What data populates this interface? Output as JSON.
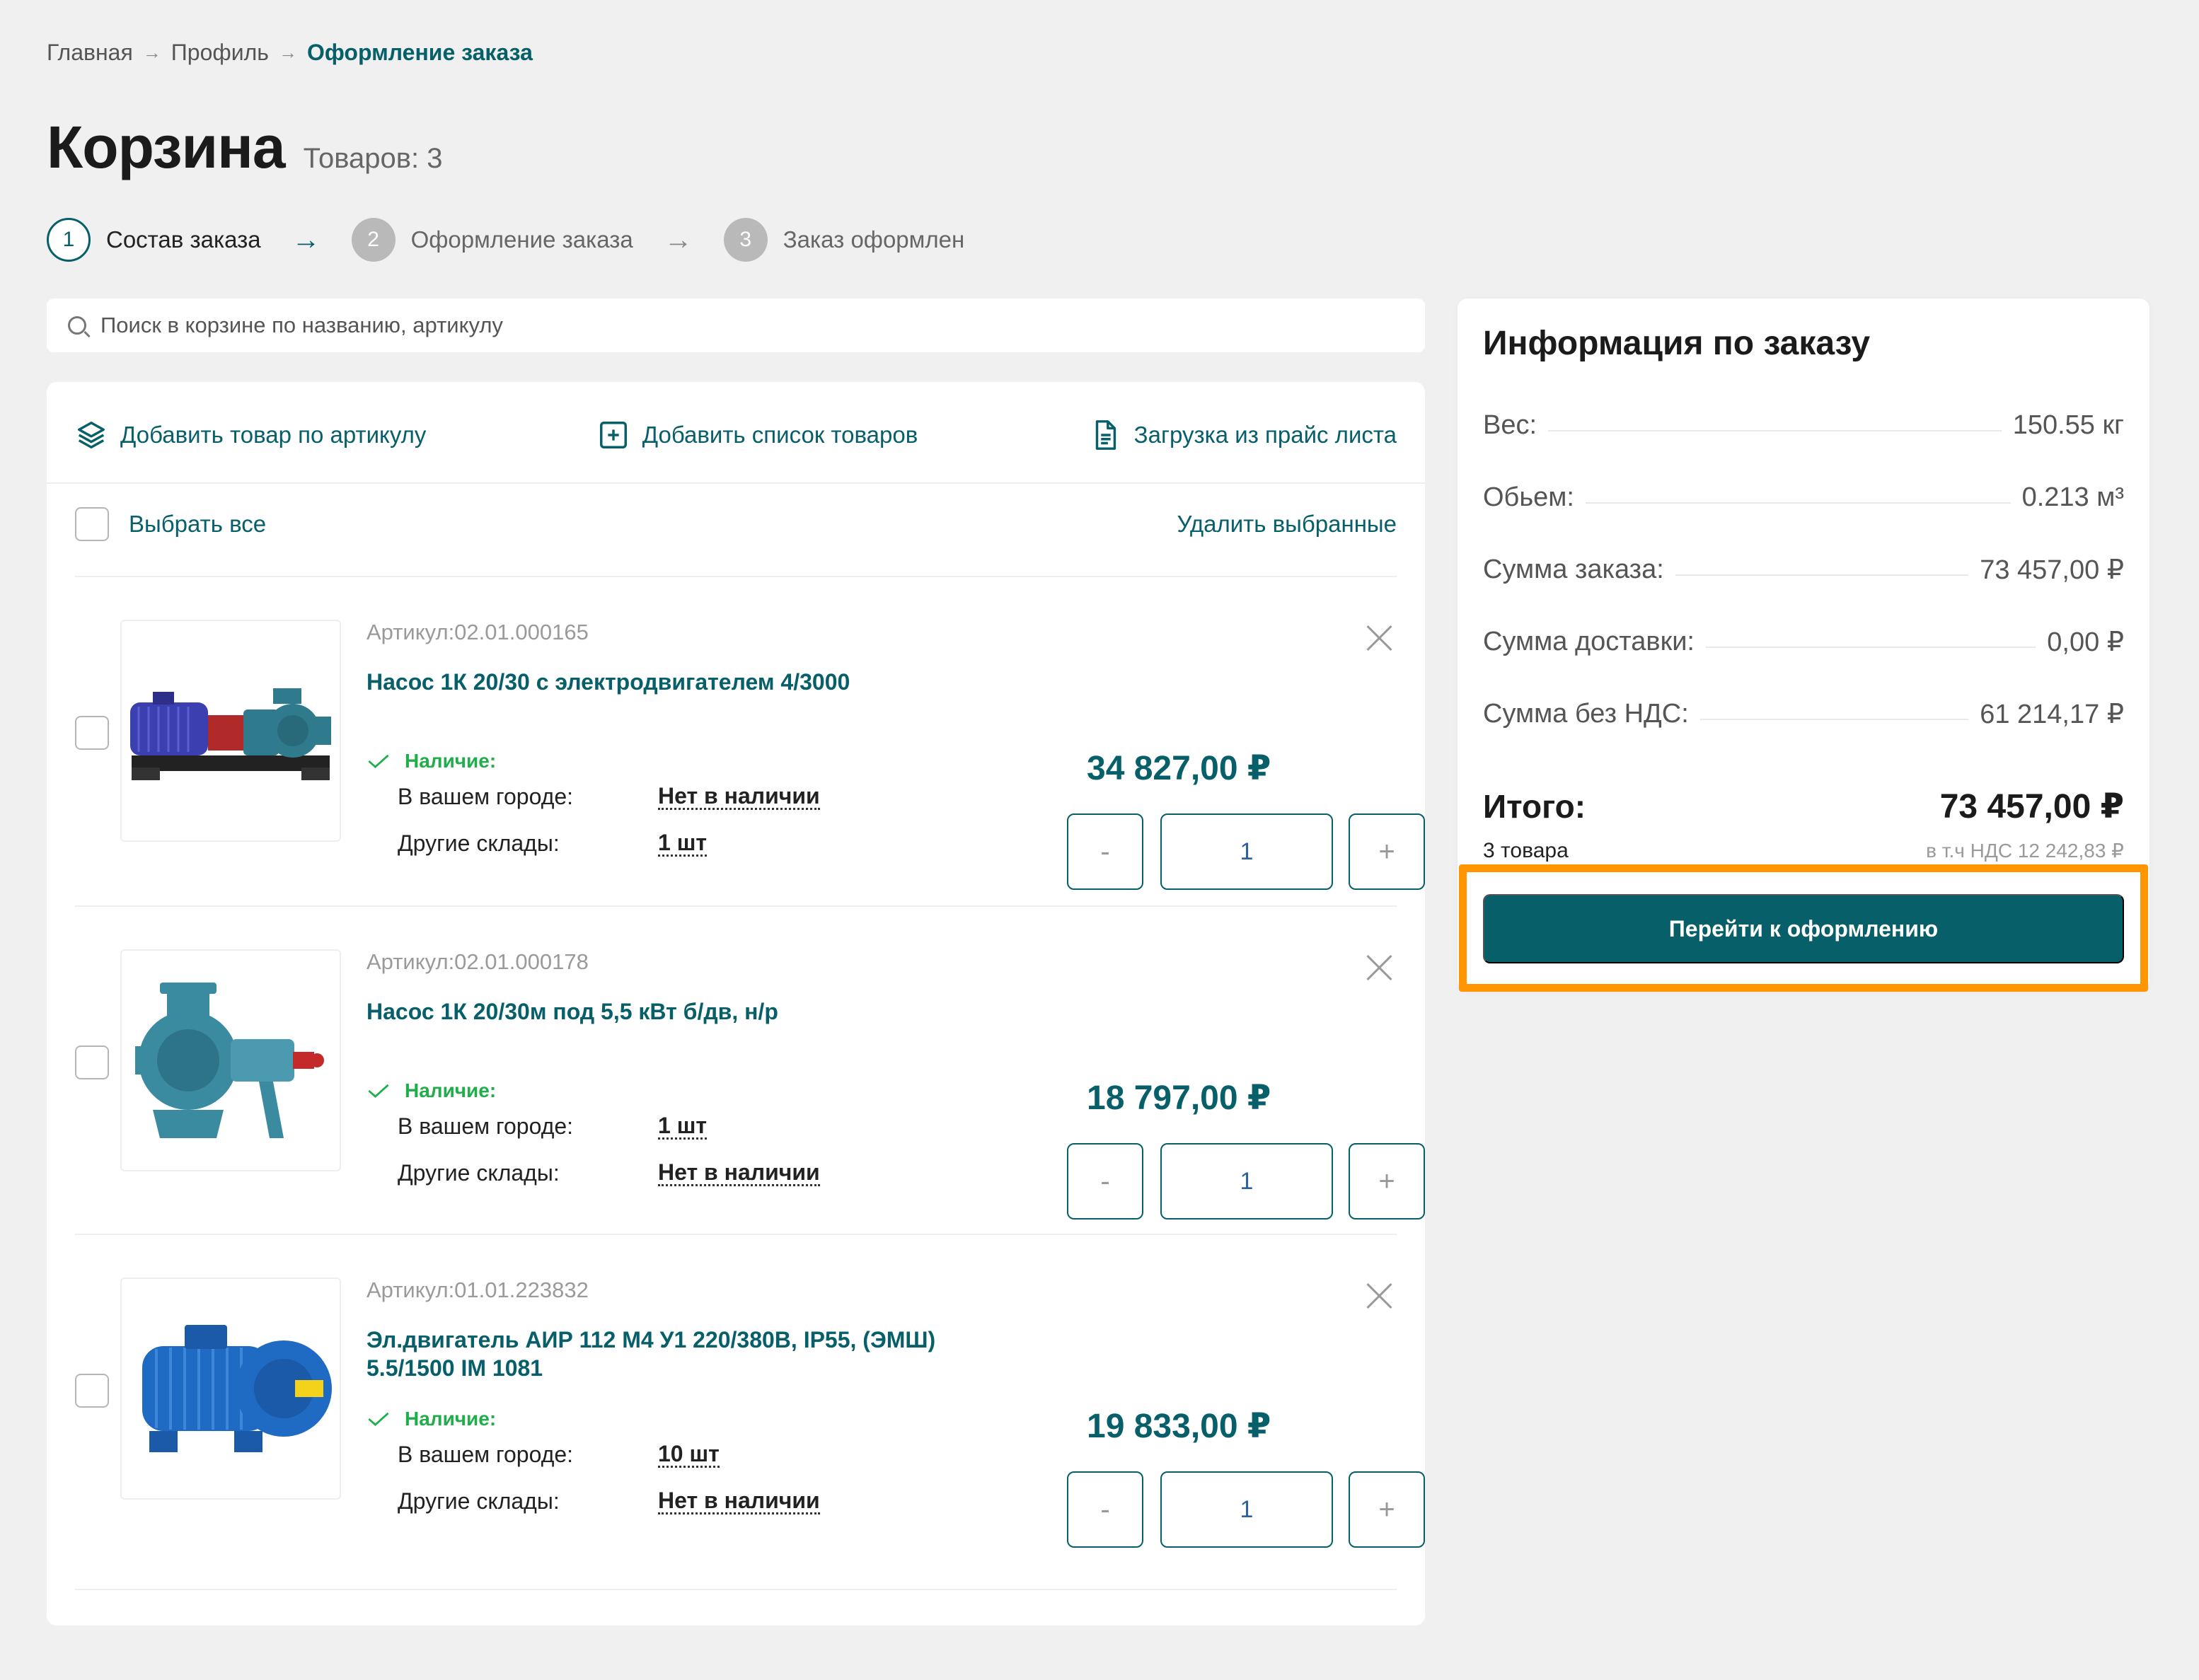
{
  "breadcrumb": {
    "items": [
      "Главная",
      "Профиль",
      "Оформление заказа"
    ],
    "separator": "→"
  },
  "page": {
    "title": "Корзина",
    "items_count": "Товаров: 3"
  },
  "steps": [
    {
      "num": "1",
      "label": "Состав заказа",
      "active": true
    },
    {
      "num": "2",
      "label": "Оформление заказа",
      "active": false
    },
    {
      "num": "3",
      "label": "Заказ оформлен",
      "active": false
    }
  ],
  "search": {
    "placeholder": "Поиск в корзине по названию, артикулу",
    "value": ""
  },
  "actions": {
    "add_by_sku": "Добавить товар по артикулу",
    "add_list": "Добавить список товаров",
    "upload_price": "Загрузка из прайс листа"
  },
  "selection": {
    "select_all": "Выбрать все",
    "delete_selected": "Удалить выбранные"
  },
  "labels": {
    "availability": "Наличие:",
    "in_city": "В вашем городе:",
    "other_warehouses": "Другие склады:",
    "minus": "-",
    "plus": "+"
  },
  "products": [
    {
      "sku": "Артикул:02.01.000165",
      "name": "Насос 1К 20/30 с электродвигателем 4/3000",
      "in_city": "Нет в наличии",
      "other": "1 шт",
      "price": "34 827,00 ₽",
      "qty": "1"
    },
    {
      "sku": "Артикул:02.01.000178",
      "name": "Насос 1К 20/30м под 5,5 кВт б/дв, н/р",
      "in_city": "1 шт",
      "other": "Нет в наличии",
      "price": "18 797,00 ₽",
      "qty": "1"
    },
    {
      "sku": "Артикул:01.01.223832",
      "name": "Эл.двигатель АИР 112 М4 У1 220/380В, IP55, (ЭМШ) 5.5/1500 IM 1081",
      "in_city": "10 шт",
      "other": "Нет в наличии",
      "price": "19 833,00 ₽",
      "qty": "1"
    }
  ],
  "summary": {
    "title": "Информация по заказу",
    "rows": [
      {
        "label": "Вес:",
        "value": "150.55 кг"
      },
      {
        "label": "Обьем:",
        "value": "0.213 м³"
      },
      {
        "label": "Сумма заказа:",
        "value": "73 457,00 ₽"
      },
      {
        "label": "Сумма доставки:",
        "value": "0,00 ₽"
      },
      {
        "label": "Сумма без НДС:",
        "value": "61 214,17 ₽"
      }
    ],
    "total_label": "Итого:",
    "total_value": "73 457,00 ₽",
    "items_count": "3 товара",
    "vat_note": "в т.ч НДС 12 242,83 ₽",
    "checkout_button": "Перейти к оформлению"
  },
  "colors": {
    "accent": "#075f69",
    "highlight": "#ff9500",
    "in_stock": "#1fae4a"
  }
}
